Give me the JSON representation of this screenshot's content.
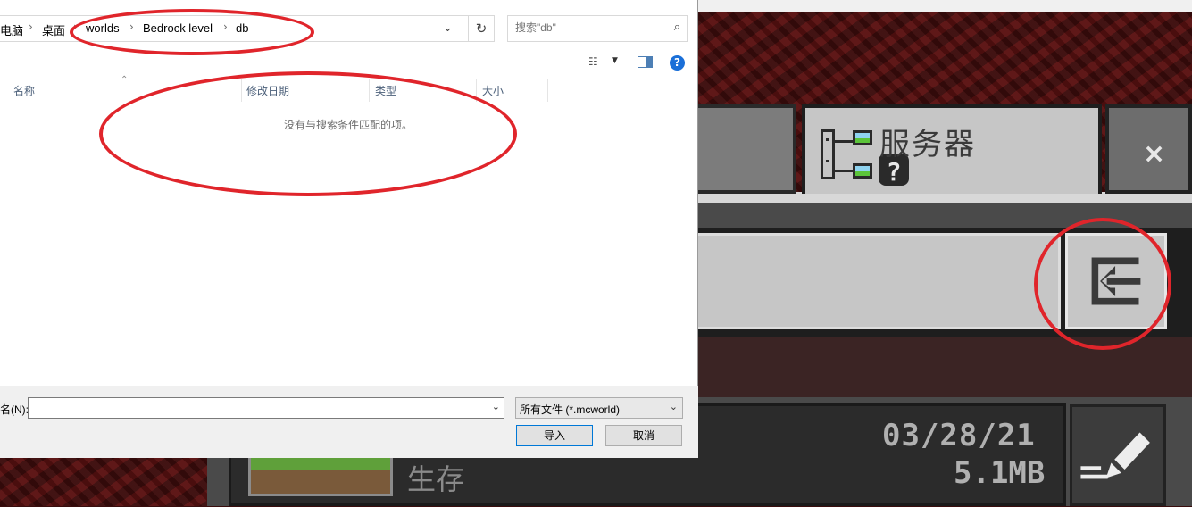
{
  "file_dialog": {
    "breadcrumb": [
      "电脑",
      "桌面",
      "worlds",
      "Bedrock level",
      "db"
    ],
    "search_placeholder": "搜索\"db\"",
    "columns": [
      "名称",
      "修改日期",
      "类型",
      "大小"
    ],
    "empty_message": "没有与搜索条件匹配的项。",
    "filename_label": "名(N):",
    "filename_value": "",
    "filetype": "所有文件 (*.mcworld)",
    "open_button": "导入",
    "cancel_button": "取消"
  },
  "minecraft": {
    "servers_tab": "服务器",
    "close_label": "×",
    "world": {
      "mode": "生存",
      "date": "03/28/21",
      "size": "5.1MB"
    }
  },
  "colors": {
    "annotation": "#e0252b",
    "mc_button": "#c6c6c6",
    "accent_blue": "#0078d7"
  },
  "icons": [
    "server-icon",
    "close-icon",
    "import-icon",
    "edit-pencil-icon",
    "search-icon",
    "refresh-icon",
    "help-icon",
    "view-icon",
    "preview-pane-icon"
  ]
}
